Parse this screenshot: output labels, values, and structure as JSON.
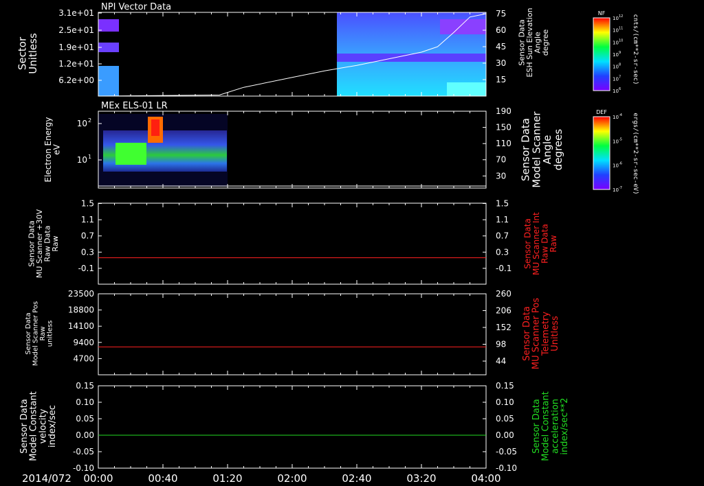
{
  "date_label": "2014/072",
  "time_ticks": [
    "00:00",
    "00:40",
    "01:20",
    "02:00",
    "02:40",
    "03:20",
    "04:00"
  ],
  "colors": {
    "red": "#ff2020",
    "green": "#22dd22",
    "white": "#ffffff"
  },
  "chart_data": [
    {
      "type": "heatmap",
      "title": "NPI Vector Data",
      "ylabel": [
        "Sector",
        "Unitless"
      ],
      "yticks": [
        "3.1e+01",
        "2.5e+01",
        "1.9e+01",
        "1.2e+01",
        "6.2e+00"
      ],
      "right_ylabel": [
        "Sensor Data",
        "ESH Sun Elevation",
        "Angle",
        "degree"
      ],
      "right_yticks": [
        75,
        60,
        45,
        30,
        15
      ],
      "right_ylim": [
        0,
        75
      ],
      "series": [
        {
          "name": "ESH Sun Elevation Angle",
          "x": [
            "00:00",
            "01:15",
            "01:30",
            "02:00",
            "02:20",
            "02:40",
            "03:00",
            "03:20",
            "03:30",
            "03:40",
            "03:50",
            "04:00"
          ],
          "y": [
            0,
            1,
            8,
            17,
            23,
            28,
            34,
            40,
            45,
            58,
            72,
            75
          ]
        }
      ],
      "colorbar": {
        "label": "NF",
        "units": "cnts/(cm**2-sr-sec)",
        "ticks": [
          "10^12",
          "10^11",
          "10^10",
          "10^9",
          "10^8",
          "10^7",
          "10^6"
        ]
      }
    },
    {
      "type": "heatmap",
      "title": "MEx ELS-01 LR",
      "ylabel": [
        "Electron Energy",
        "eV"
      ],
      "yticks": [
        "10^2",
        "10^1"
      ],
      "right_ylabel": [
        "Sensor Data",
        "Model Scanner",
        "Angle",
        "degrees"
      ],
      "right_yticks": [
        190,
        150,
        110,
        70,
        30
      ],
      "right_ylim": [
        0,
        190
      ],
      "series": [
        {
          "name": "Model Scanner Angle",
          "x": [
            "00:00",
            "04:00"
          ],
          "y": [
            5,
            5
          ]
        }
      ],
      "colorbar": {
        "label": "DEF",
        "units": "ergs/(cm**2-sr-sec-eV)",
        "ticks": [
          "10^-4",
          "10^-5",
          "10^-6",
          "10^-7"
        ]
      }
    },
    {
      "type": "line",
      "ylabel": [
        "Sensor Data",
        "MU Scanner +30V",
        "Raw Data",
        "Raw"
      ],
      "yticks": [
        "1.5",
        "1.1",
        "0.7",
        "0.3",
        "-0.1"
      ],
      "ylim": [
        -0.5,
        1.5
      ],
      "right_ylabel": [
        "Sensor Data",
        "MU Scanner Int",
        "Raw Data",
        "Raw"
      ],
      "right_yticks": [
        "1.5",
        "1.1",
        "0.7",
        "0.3",
        "-0.1"
      ],
      "series": [
        {
          "x": [
            "00:00",
            "04:00"
          ],
          "y": [
            0,
            0
          ]
        }
      ]
    },
    {
      "type": "line",
      "ylabel": [
        "Sensor Data",
        "Model Scanner Pos",
        "Raw",
        "unitless"
      ],
      "yticks": [
        "23500",
        "18800",
        "14100",
        "9400",
        "4700"
      ],
      "ylim": [
        0,
        23500
      ],
      "right_ylabel": [
        "Sensor Data",
        "MU Scanner Pos",
        "Telemetry",
        "Unitless"
      ],
      "right_yticks": [
        "260",
        "206",
        "152",
        "98",
        "44"
      ],
      "series": [
        {
          "x": [
            "00:00",
            "04:00"
          ],
          "y": [
            8100,
            8100
          ]
        }
      ]
    },
    {
      "type": "line",
      "ylabel": [
        "Sensor Data",
        "Model Constant",
        "velocity",
        "index/sec"
      ],
      "yticks": [
        "0.15",
        "0.10",
        "0.05",
        "0.00",
        "-0.05",
        "-0.10"
      ],
      "ylim": [
        -0.1,
        0.15
      ],
      "right_ylabel": [
        "Sensor Data",
        "Model Constant",
        "acceleration",
        "index/sec**2"
      ],
      "right_yticks": [
        "0.15",
        "0.10",
        "0.05",
        "0.00",
        "-0.05",
        "-0.10"
      ],
      "series": [
        {
          "x": [
            "00:00",
            "04:00"
          ],
          "y": [
            0,
            0
          ]
        }
      ]
    }
  ]
}
